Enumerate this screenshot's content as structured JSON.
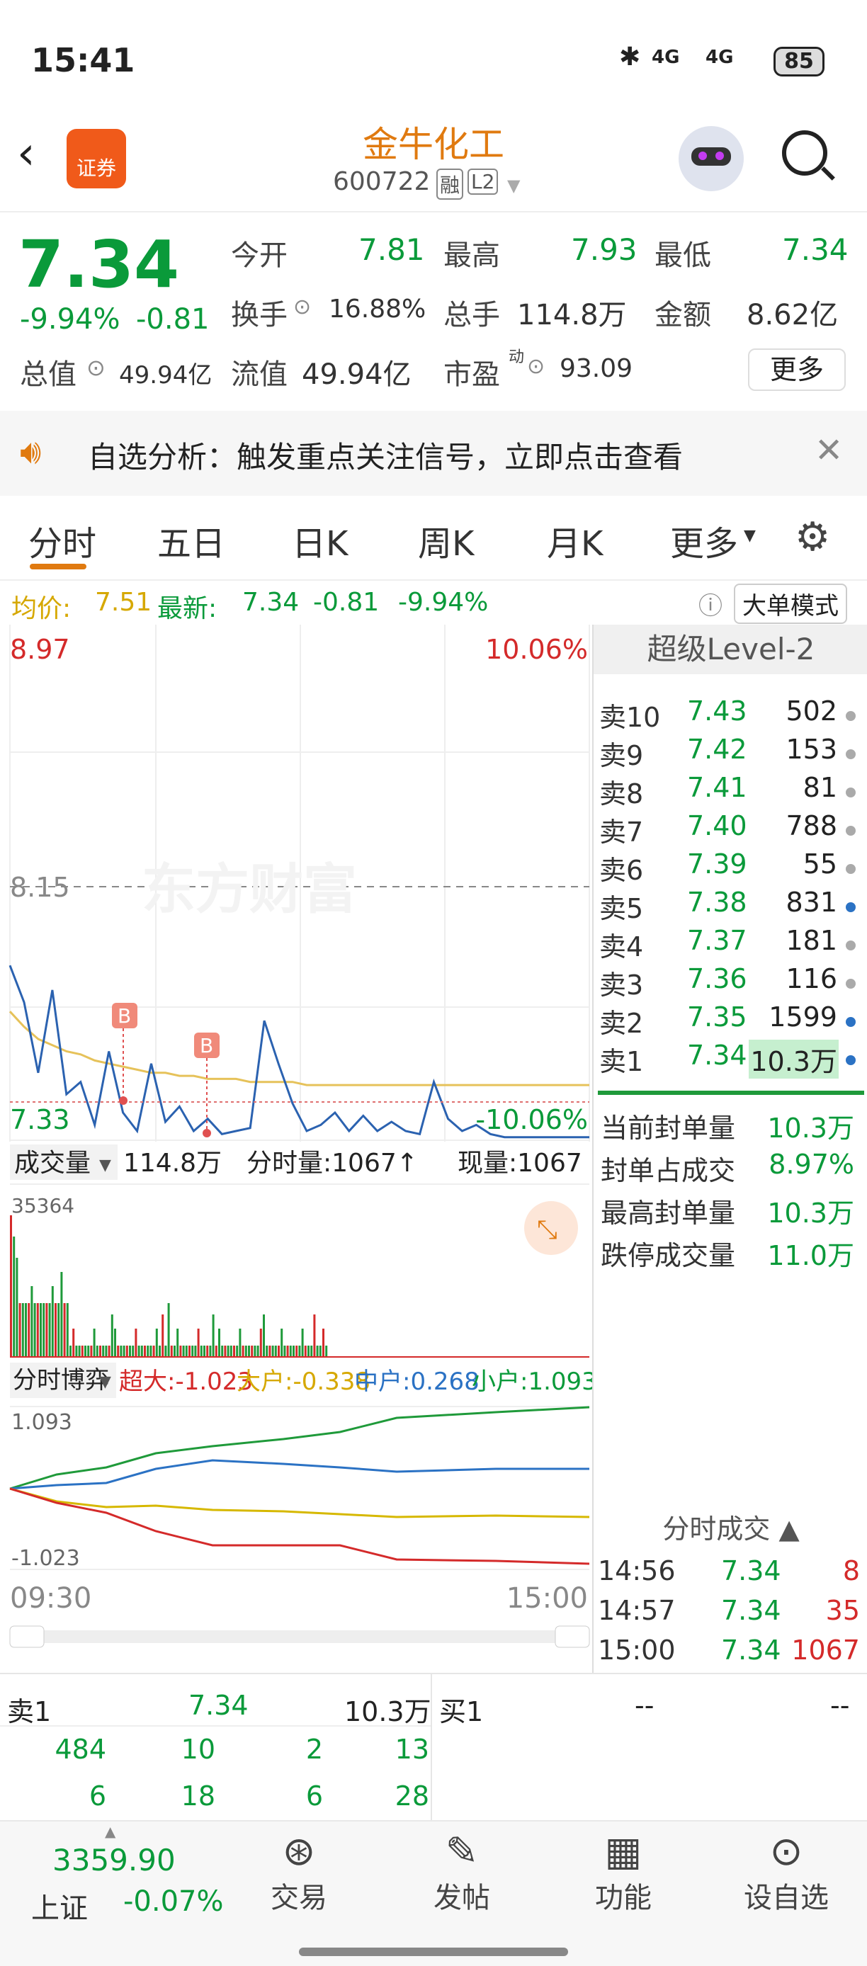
{
  "status": {
    "time": "15:41",
    "net1": "4G",
    "net2": "4G",
    "battery": "85"
  },
  "header": {
    "badge": "证券",
    "name": "金牛化工",
    "code": "600722",
    "tag1": "融",
    "tag2": "L2"
  },
  "quote": {
    "price": "7.34",
    "pct": "-9.94%",
    "chg": "-0.81",
    "open_l": "今开",
    "open": "7.81",
    "high_l": "最高",
    "high": "7.93",
    "low_l": "最低",
    "low": "7.34",
    "turn_l": "换手",
    "turn": "16.88%",
    "vol_l": "总手",
    "vol": "114.8万",
    "amt_l": "金额",
    "amt": "8.62亿",
    "cap_l": "总值",
    "cap": "49.94亿",
    "float_l": "流值",
    "float": "49.94亿",
    "pe_l": "市盈",
    "pe_sup": "动",
    "pe": "93.09",
    "more": "更多"
  },
  "notice": {
    "text": "自选分析：触发重点关注信号，立即点击查看"
  },
  "tabs": [
    "分时",
    "五日",
    "日K",
    "周K",
    "月K",
    "更多"
  ],
  "avgline": {
    "avg_l": "均价:",
    "avg": "7.51",
    "last_l": "最新:",
    "last": "7.34",
    "chg": "-0.81",
    "pct": "-9.94%",
    "mode": "大单模式"
  },
  "chart": {
    "ytop": "8.97",
    "ymid": "8.15",
    "ybot": "7.33",
    "ptop": "10.06%",
    "pbot": "-10.06%",
    "watermark": "东方财富",
    "marker": "B",
    "vol_l": "成交量",
    "vol": "114.8万",
    "tick_l": "分时量:1067↑",
    "now_l": "现量:1067",
    "vol_max": "35364",
    "flow_l": "分时博弈",
    "super": "超大:-1.023",
    "big": "大户:-0.338",
    "mid": "中户:0.268",
    "small": "小户:1.093",
    "ftop": "1.093",
    "fbot": "-1.023",
    "t0": "09:30",
    "t1": "15:00"
  },
  "chart_data": {
    "type": "line",
    "title": "",
    "x_range": [
      "09:30",
      "15:00"
    ],
    "ylim": [
      7.33,
      8.97
    ],
    "prev_close": 8.15,
    "price": [
      7.9,
      7.78,
      7.55,
      7.82,
      7.48,
      7.52,
      7.38,
      7.62,
      7.42,
      7.36,
      7.58,
      7.39,
      7.44,
      7.36,
      7.4,
      7.35,
      7.36,
      7.37,
      7.72,
      7.58,
      7.45,
      7.36,
      7.38,
      7.42,
      7.36,
      7.41,
      7.36,
      7.39,
      7.36,
      7.35,
      7.52,
      7.4,
      7.36,
      7.38,
      7.35,
      7.34,
      7.34,
      7.34,
      7.34,
      7.34,
      7.34,
      7.34
    ],
    "avg": [
      7.75,
      7.7,
      7.66,
      7.64,
      7.62,
      7.61,
      7.59,
      7.58,
      7.57,
      7.56,
      7.55,
      7.55,
      7.54,
      7.54,
      7.53,
      7.53,
      7.53,
      7.52,
      7.52,
      7.52,
      7.52,
      7.51,
      7.51,
      7.51,
      7.51,
      7.51,
      7.51,
      7.51,
      7.51,
      7.51,
      7.51,
      7.51,
      7.51,
      7.51,
      7.51,
      7.51,
      7.51,
      7.51,
      7.51,
      7.51,
      7.51,
      7.51
    ]
  },
  "level2": {
    "title": "超级Level-2",
    "asks": [
      {
        "l": "卖10",
        "p": "7.43",
        "v": "502",
        "c": "gray"
      },
      {
        "l": "卖9",
        "p": "7.42",
        "v": "153",
        "c": "gray"
      },
      {
        "l": "卖8",
        "p": "7.41",
        "v": "81",
        "c": "gray"
      },
      {
        "l": "卖7",
        "p": "7.40",
        "v": "788",
        "c": "gray"
      },
      {
        "l": "卖6",
        "p": "7.39",
        "v": "55",
        "c": "gray"
      },
      {
        "l": "卖5",
        "p": "7.38",
        "v": "831",
        "c": "blue"
      },
      {
        "l": "卖4",
        "p": "7.37",
        "v": "181",
        "c": "gray"
      },
      {
        "l": "卖3",
        "p": "7.36",
        "v": "116",
        "c": "gray"
      },
      {
        "l": "卖2",
        "p": "7.35",
        "v": "1599",
        "c": "blue"
      },
      {
        "l": "卖1",
        "p": "7.34",
        "v": "10.3万",
        "c": "blue"
      }
    ],
    "stats": [
      {
        "l": "当前封单量",
        "v": "10.3万"
      },
      {
        "l": "封单占成交",
        "v": "8.97%"
      },
      {
        "l": "最高封单量",
        "v": "10.3万"
      },
      {
        "l": "跌停成交量",
        "v": "11.0万"
      }
    ],
    "trades_l": "分时成交",
    "trades": [
      {
        "t": "14:56",
        "p": "7.34",
        "v": "8"
      },
      {
        "t": "14:57",
        "p": "7.34",
        "v": "35"
      },
      {
        "t": "15:00",
        "p": "7.34",
        "v": "1067"
      }
    ]
  },
  "queue": {
    "ask_l": "卖1",
    "ask_p": "7.34",
    "ask_v": "10.3万",
    "bid_l": "买1",
    "bid_p": "--",
    "bid_v": "--",
    "rows": [
      [
        "484",
        "10",
        "2",
        "13"
      ],
      [
        "6",
        "18",
        "6",
        "28"
      ]
    ]
  },
  "bottom": {
    "index_v": "3359.90",
    "index_n": "上证",
    "index_p": "-0.07%",
    "trade": "交易",
    "post": "发帖",
    "func": "功能",
    "fav": "设自选"
  }
}
